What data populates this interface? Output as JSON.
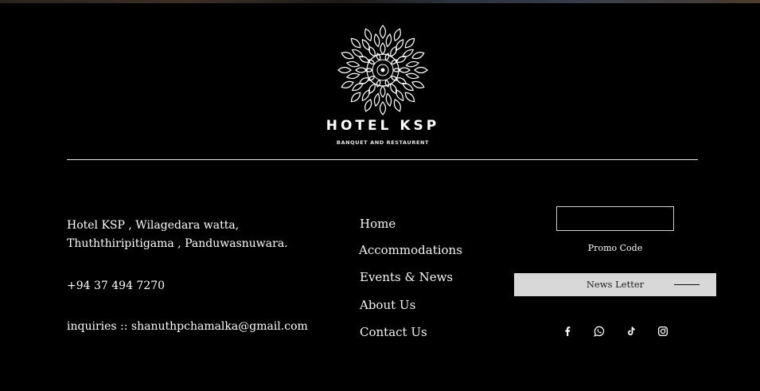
{
  "brand": {
    "name": "HOTEL KSP",
    "tagline": "BANQUET AND RESTAURENT"
  },
  "contact": {
    "address_line1": "Hotel KSP , Wilagedara watta,",
    "address_line2": "Thuththiripitigama ,  Panduwasnuwara.",
    "phone": "+94 37 494 7270",
    "email": "inquiries :: shanuthpchamalka@gmail.com"
  },
  "nav": {
    "home": "Home",
    "accommodations": "Accommodations",
    "events": "Events & News",
    "about": "About Us",
    "contact": "Contact Us"
  },
  "promo": {
    "value": "",
    "label": "Promo Code"
  },
  "newsletter": {
    "label": "News Letter"
  },
  "social": [
    "facebook-icon",
    "whatsapp-icon",
    "tiktok-icon",
    "instagram-icon"
  ],
  "colors": {
    "background": "#000000",
    "text": "#ffffff",
    "newsletter_bg": "#d8d8d8"
  }
}
